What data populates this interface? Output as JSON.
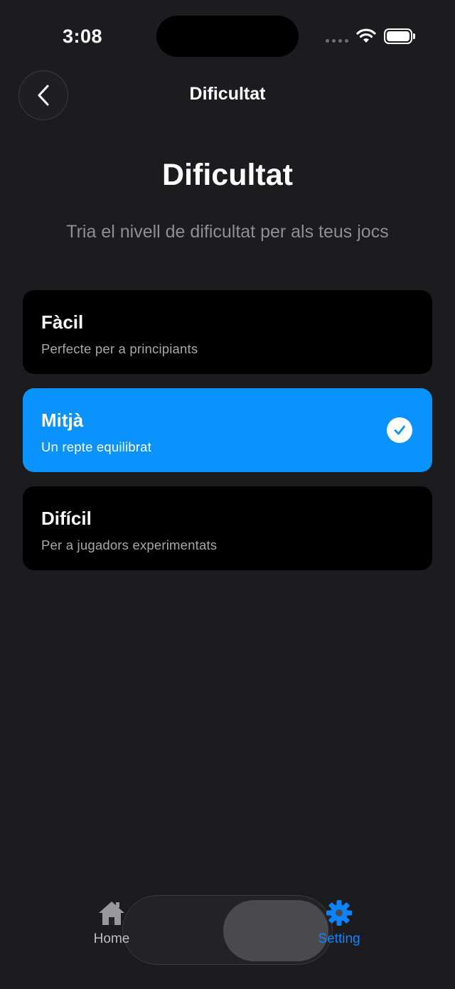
{
  "status_bar": {
    "time": "3:08"
  },
  "nav": {
    "title": "Dificultat",
    "back_icon": "chevron-left-icon"
  },
  "header": {
    "title": "Dificultat",
    "subtitle": "Tria el nivell de dificultat per als teus jocs"
  },
  "options": [
    {
      "title": "Fàcil",
      "description": "Perfecte per a principiants",
      "selected": false
    },
    {
      "title": "Mitjà",
      "description": "Un repte equilibrat",
      "selected": true
    },
    {
      "title": "Difícil",
      "description": "Per a jugadors experimentats",
      "selected": false
    }
  ],
  "tabs": [
    {
      "label": "Home",
      "icon": "house-icon",
      "active": false
    },
    {
      "label": "Setting",
      "icon": "gear-icon",
      "active": true
    }
  ],
  "colors": {
    "background": "#1c1c1e",
    "card": "#000000",
    "accent": "#0a93ff",
    "tab_active": "#0a84ff",
    "secondary_text": "#8e8e93"
  }
}
